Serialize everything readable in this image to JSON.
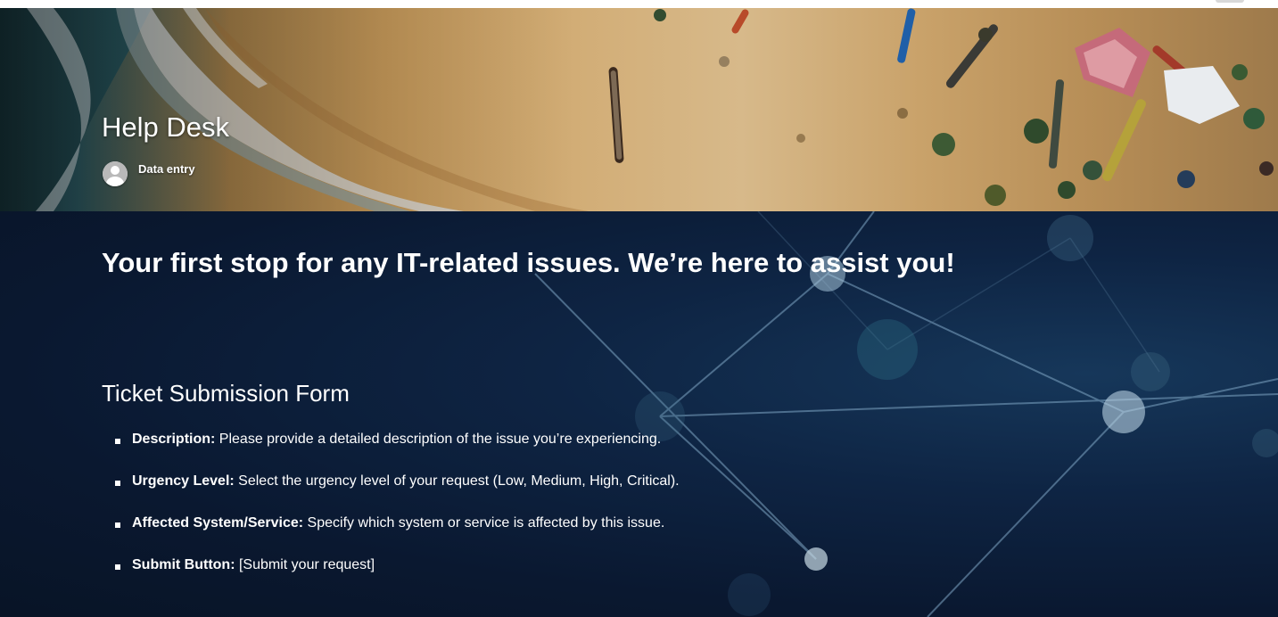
{
  "hero": {
    "title": "Help Desk",
    "author": "Data entry"
  },
  "main": {
    "tagline": "Your first stop for any IT-related issues. We’re here to assist you!",
    "form_heading": "Ticket Submission Form",
    "fields": [
      {
        "name": "Description:",
        "text": " Please provide a detailed description of the issue you’re experiencing."
      },
      {
        "name": "Urgency Level:",
        "text": " Select the urgency level of your request (Low, Medium, High, Critical)."
      },
      {
        "name": "Affected System/Service:",
        "text": " Specify which system or service is affected by this issue."
      },
      {
        "name": "Submit Button:",
        "text": " [Submit your request]"
      }
    ]
  },
  "colors": {
    "hero_sand": "#c79a5a",
    "hero_sea": "#1e3b44",
    "content_background": "#0b1a33",
    "text": "#ffffff"
  },
  "icons": {
    "author_avatar": "person-avatar-icon",
    "list_bullet": "square-bullet-icon"
  }
}
